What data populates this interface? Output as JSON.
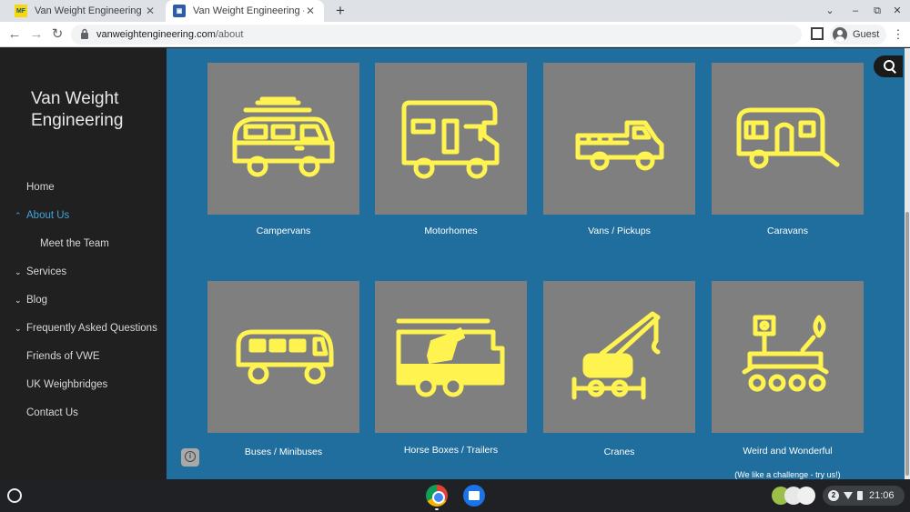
{
  "browser": {
    "tabs": [
      {
        "favicon": "MF",
        "title": "Van Weight Engineering - A New",
        "close": "✕"
      },
      {
        "favicon": "▣",
        "title": "Van Weight Engineering - About",
        "close": "✕"
      }
    ],
    "new_tab": "+",
    "window_controls": {
      "dropdown": "⌄",
      "minimize": "–",
      "restore": "⧉",
      "close": "✕"
    },
    "nav": {
      "back": "←",
      "forward": "→",
      "reload": "↻"
    },
    "url_host": "vanweightengineering.com",
    "url_path": "/about",
    "profile_label": "Guest",
    "menu": "⋮"
  },
  "sidebar": {
    "site_title": "Van Weight Engineering",
    "items": [
      {
        "label": "Home",
        "arrow": ""
      },
      {
        "label": "About Us",
        "arrow": "⌃"
      },
      {
        "label": "Meet the Team",
        "arrow": ""
      },
      {
        "label": "Services",
        "arrow": "⌄"
      },
      {
        "label": "Blog",
        "arrow": "⌄"
      },
      {
        "label": "Frequently Asked Questions",
        "arrow": "⌄"
      },
      {
        "label": "Friends of VWE",
        "arrow": ""
      },
      {
        "label": "UK Weighbridges",
        "arrow": ""
      },
      {
        "label": "Contact Us",
        "arrow": ""
      }
    ]
  },
  "cards": [
    {
      "label": "Campervans",
      "icon": "campervan-icon"
    },
    {
      "label": "Motorhomes",
      "icon": "motorhome-icon"
    },
    {
      "label": "Vans / Pickups",
      "icon": "pickup-icon"
    },
    {
      "label": "Caravans",
      "icon": "caravan-icon"
    },
    {
      "label": "Buses / Minibuses",
      "icon": "bus-icon"
    },
    {
      "label": "Horse Boxes / Trailers",
      "icon": "horsebox-icon"
    },
    {
      "label": "Cranes",
      "icon": "crane-icon"
    },
    {
      "label": "Weird and Wonderful",
      "sublabel": "(We like a challenge - try us!)",
      "icon": "rover-icon"
    }
  ],
  "colors": {
    "page_background": "#1f6e9d",
    "sidebar_background": "#202020",
    "card_background": "#7f7f7f",
    "icon_yellow": "#fff44f",
    "active_nav": "#41a3d9"
  },
  "shelf": {
    "notification_count": "2",
    "time": "21:06"
  }
}
